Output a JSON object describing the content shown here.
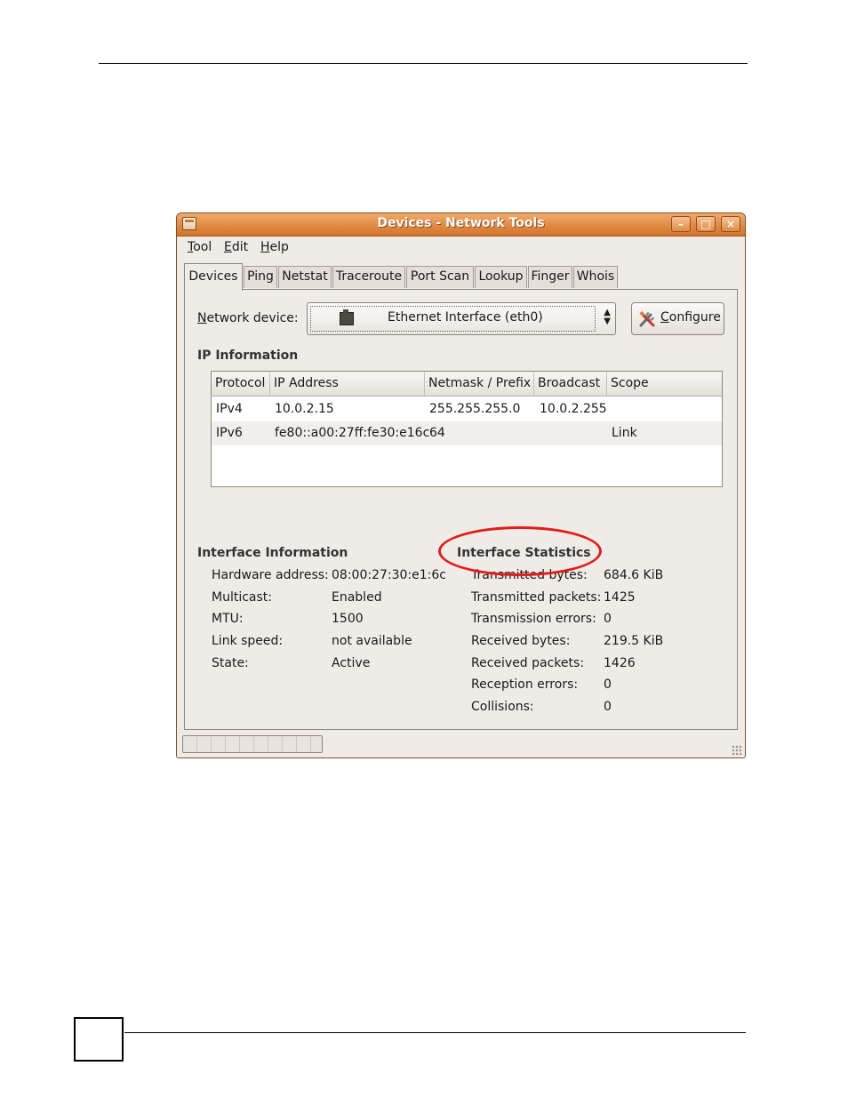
{
  "window": {
    "title": "Devices - Network Tools",
    "controls": [
      "–",
      "□",
      "×"
    ]
  },
  "menu": [
    {
      "label": "Tool",
      "mnemonic": "T",
      "rest": "ool"
    },
    {
      "label": "Edit",
      "mnemonic": "E",
      "rest": "dit"
    },
    {
      "label": "Help",
      "mnemonic": "H",
      "rest": "elp"
    }
  ],
  "tabs": [
    "Devices",
    "Ping",
    "Netstat",
    "Traceroute",
    "Port Scan",
    "Lookup",
    "Finger",
    "Whois"
  ],
  "active_tab": "Devices",
  "device": {
    "label_mnemonic": "N",
    "label_rest": "etwork device:",
    "selected": "Ethernet Interface (eth0)",
    "icon": "ethernet-icon"
  },
  "configure": {
    "mnemonic": "C",
    "rest": "onfigure",
    "icon": "tools-icon"
  },
  "ip_info": {
    "title": "IP Information",
    "columns": [
      "Protocol",
      "IP Address",
      "Netmask / Prefix",
      "Broadcast",
      "Scope"
    ],
    "rows": [
      {
        "protocol": "IPv4",
        "ip": "10.0.2.15",
        "netmask": "255.255.255.0",
        "broadcast": "10.0.2.255",
        "scope": ""
      },
      {
        "protocol": "IPv6",
        "ip": "fe80::a00:27ff:fe30:e16c",
        "netmask": "64",
        "broadcast": "",
        "scope": "Link"
      }
    ]
  },
  "interface_info": {
    "title": "Interface Information",
    "fields": [
      {
        "label": "Hardware address:",
        "value": "08:00:27:30:e1:6c"
      },
      {
        "label": "Multicast:",
        "value": "Enabled"
      },
      {
        "label": "MTU:",
        "value": "1500"
      },
      {
        "label": "Link speed:",
        "value": "not available"
      },
      {
        "label": "State:",
        "value": "Active"
      }
    ]
  },
  "interface_stats": {
    "title": "Interface Statistics",
    "fields": [
      {
        "label": "Transmitted bytes:",
        "value": "684.6 KiB"
      },
      {
        "label": "Transmitted packets:",
        "value": "1425"
      },
      {
        "label": "Transmission errors:",
        "value": "0"
      },
      {
        "label": "Received bytes:",
        "value": "219.5 KiB"
      },
      {
        "label": "Received packets:",
        "value": "1426"
      },
      {
        "label": "Reception errors:",
        "value": "0"
      },
      {
        "label": "Collisions:",
        "value": "0"
      }
    ]
  },
  "colors": {
    "titlebar": "#e28a43",
    "window_bg": "#efebe7",
    "highlight_circle": "#e31b1b"
  }
}
